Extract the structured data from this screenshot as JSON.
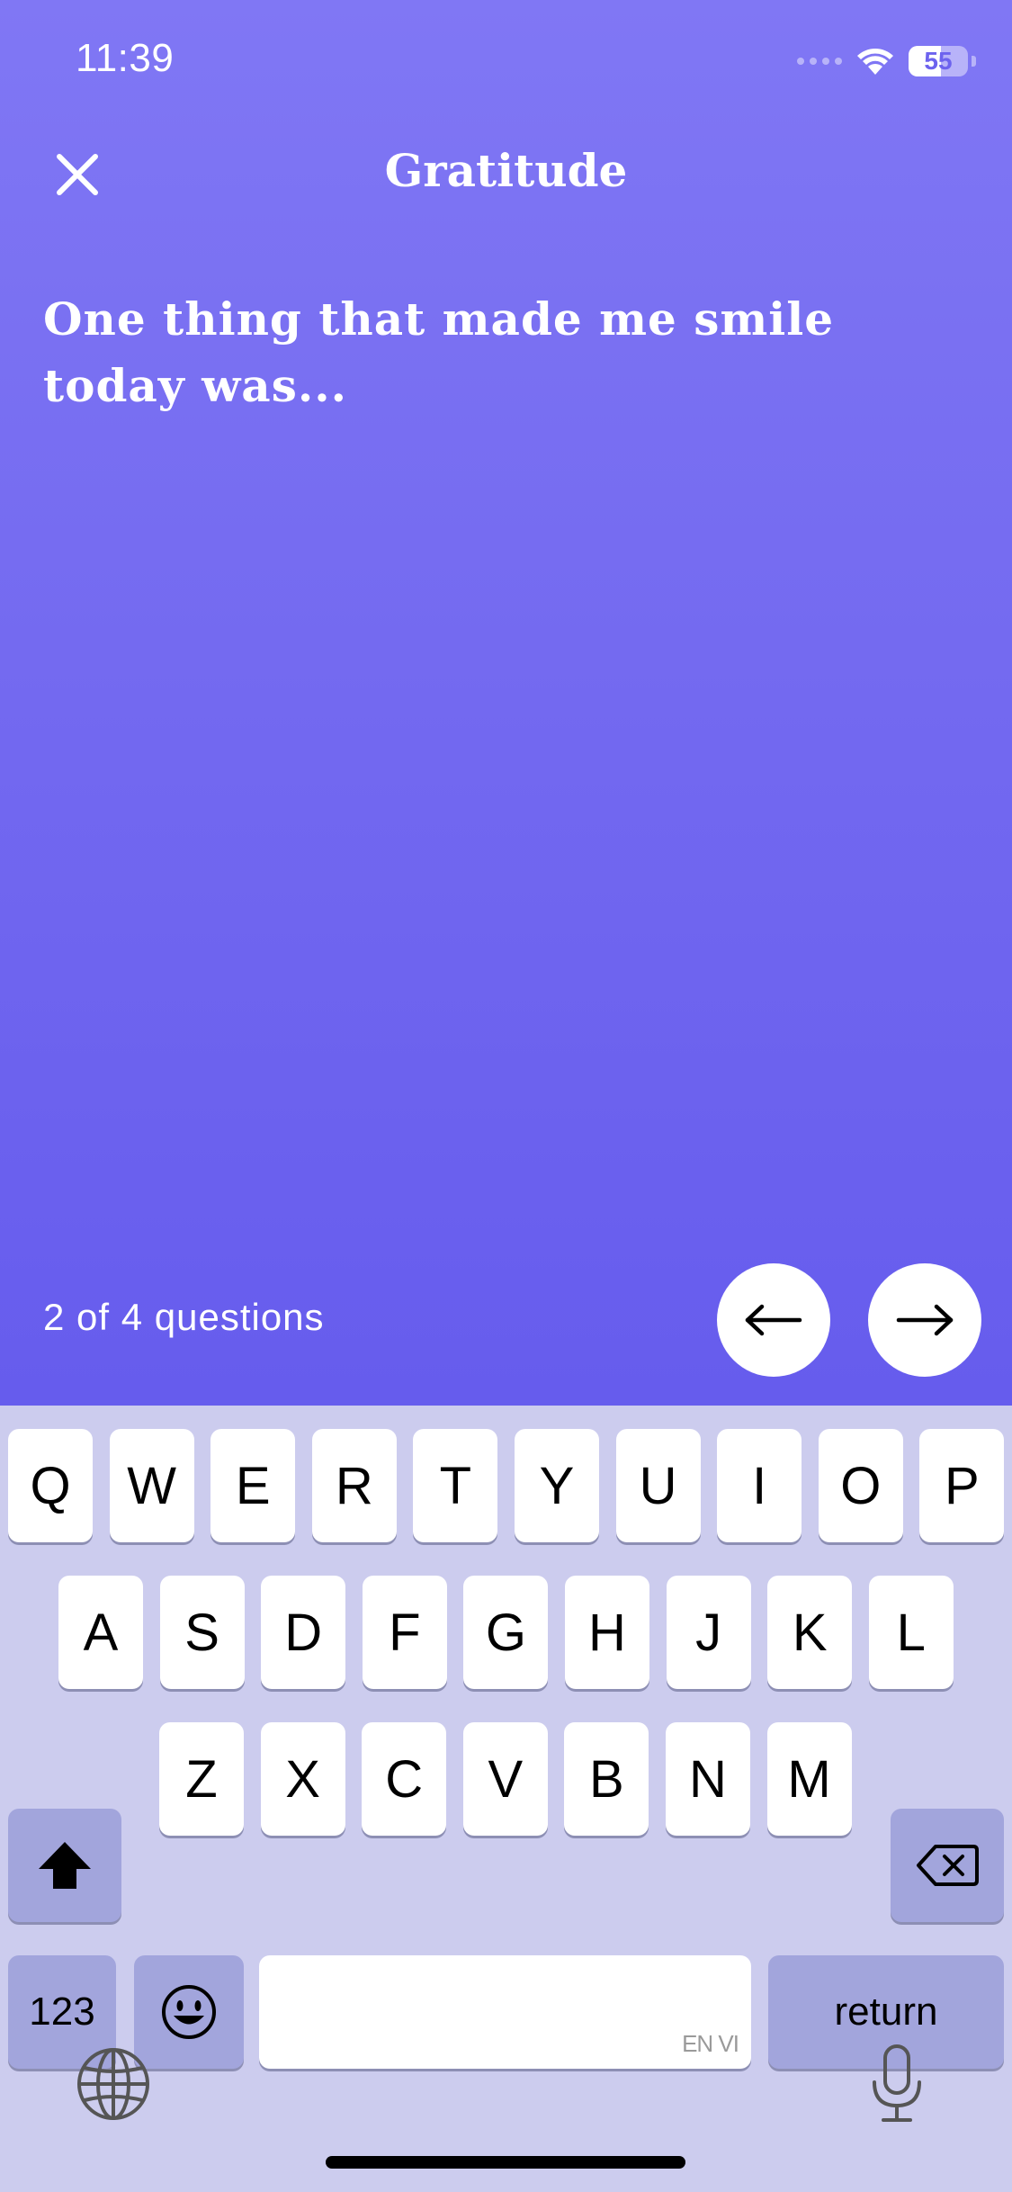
{
  "status_bar": {
    "time": "11:39",
    "battery": "55",
    "battery_level": 0.55
  },
  "header": {
    "title": "Gratitude",
    "close_icon": "close-icon"
  },
  "prompt": {
    "text": "One thing that made me smile today was..."
  },
  "footer": {
    "progress": "2 of 4 questions",
    "prev_icon": "arrow-left-icon",
    "next_icon": "arrow-right-icon"
  },
  "keyboard": {
    "row1": [
      "Q",
      "W",
      "E",
      "R",
      "T",
      "Y",
      "U",
      "I",
      "O",
      "P"
    ],
    "row2": [
      "A",
      "S",
      "D",
      "F",
      "G",
      "H",
      "J",
      "K",
      "L"
    ],
    "row3": [
      "Z",
      "X",
      "C",
      "V",
      "B",
      "N",
      "M"
    ],
    "numbers_label": "123",
    "return_label": "return",
    "space_hint": "EN VI"
  },
  "colors": {
    "background_top": "#8077f4",
    "background_bottom": "#665ced",
    "keyboard_bg": "#ccccee",
    "dark_key": "#a2a5dc"
  }
}
